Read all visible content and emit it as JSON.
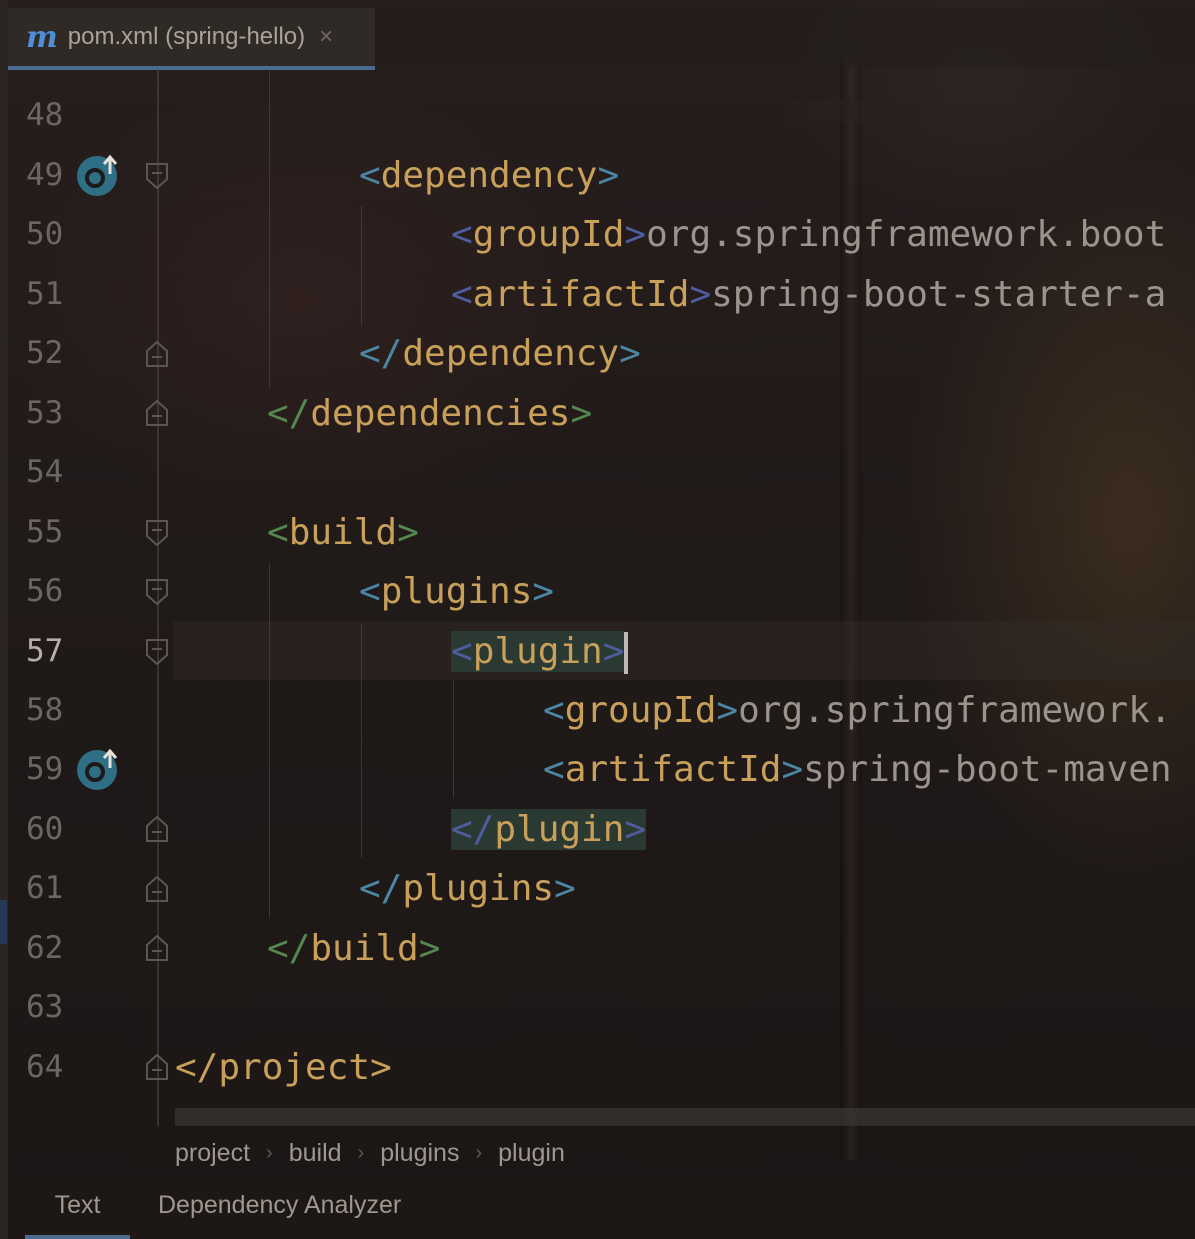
{
  "tab": {
    "icon": "maven-m-icon",
    "label": "pom.xml (spring-hello)",
    "close": "×"
  },
  "gutter": {
    "line_numbers": [
      "48",
      "49",
      "50",
      "51",
      "52",
      "53",
      "54",
      "55",
      "56",
      "57",
      "58",
      "59",
      "60",
      "61",
      "62",
      "63",
      "64"
    ],
    "current_line": "57"
  },
  "code": {
    "l49_tag": "dependency",
    "l50_tag": "groupId",
    "l50_value": "org.springframework.boot",
    "l51_tag": "artifactId",
    "l51_value": "spring-boot-starter-a",
    "l52_tag": "dependency",
    "l53_tag": "dependencies",
    "l55_tag": "build",
    "l56_tag": "plugins",
    "l57_tag": "plugin",
    "l58_tag": "groupId",
    "l58_value": "org.springframework.",
    "l59_tag": "artifactId",
    "l59_value": "spring-boot-maven",
    "l60_tag": "plugin",
    "l61_tag": "plugins",
    "l62_tag": "build",
    "l64_tag": "project"
  },
  "breadcrumb": [
    "project",
    "build",
    "plugins",
    "plugin"
  ],
  "bottom_tabs": [
    "Text",
    "Dependency Analyzer"
  ],
  "colors": {
    "tag": "#c8a05a",
    "bracket_blue": "#4b86a4",
    "bracket_green": "#55884e",
    "value": "#9a948c",
    "accent": "#4a6c8f"
  }
}
